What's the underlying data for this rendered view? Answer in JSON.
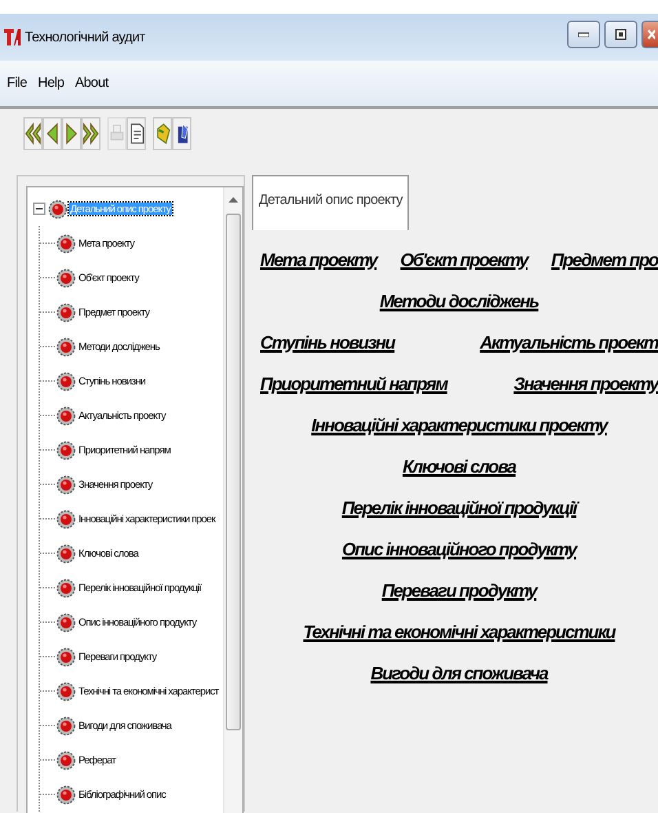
{
  "window": {
    "title": "Технологічний аудит"
  },
  "menu": [
    "File",
    "Help",
    "About"
  ],
  "toolbar": [
    {
      "kind": "first",
      "disabled": false
    },
    {
      "kind": "prev",
      "disabled": false
    },
    {
      "kind": "next",
      "disabled": false
    },
    {
      "kind": "last",
      "disabled": false
    },
    {
      "kind": "print",
      "disabled": true
    },
    {
      "kind": "document",
      "disabled": false
    },
    {
      "kind": "tool",
      "disabled": false
    },
    {
      "kind": "save",
      "disabled": false
    }
  ],
  "tree": {
    "label": "Детальний опис проекту",
    "expanded": true,
    "selected": true,
    "children": [
      {
        "label": "Мета проекту",
        "selected": false
      },
      {
        "label": "Об'єкт проекту",
        "selected": false
      },
      {
        "label": "Предмет проекту",
        "selected": false
      },
      {
        "label": "Методи досліджень",
        "selected": false
      },
      {
        "label": "Ступінь новизни",
        "selected": false
      },
      {
        "label": "Актуальність проекту",
        "selected": false
      },
      {
        "label": "Приоритетний напрям",
        "selected": false
      },
      {
        "label": "Значення проекту",
        "selected": false
      },
      {
        "label": "Інноваційні характеристики проек",
        "selected": false
      },
      {
        "label": "Ключові слова",
        "selected": false
      },
      {
        "label": "Перелік інноваційної продукції",
        "selected": false
      },
      {
        "label": "Опис інноваційного продукту",
        "selected": false
      },
      {
        "label": "Переваги продукту",
        "selected": false
      },
      {
        "label": "Технічні та економічні характерист",
        "selected": false
      },
      {
        "label": "Вигоди для споживача",
        "selected": false
      },
      {
        "label": "Реферат",
        "selected": false
      },
      {
        "label": "Бібліографічний опис",
        "selected": false
      }
    ]
  },
  "tabs": [
    {
      "label": "Детальний опис проекту",
      "selected": true
    }
  ],
  "link_rows": [
    [
      "Мета проекту",
      "Об'єкт проекту",
      "Предмет про"
    ],
    [
      "Методи досліджень"
    ],
    [
      "Ступінь новизни",
      "Актуальність проект"
    ],
    [
      "Приоритетний напрям",
      "Значення проекту"
    ],
    [
      "Інноваційні характеристики проекту"
    ],
    [
      "Ключові слова"
    ],
    [
      "Перелік інноваційної продукції"
    ],
    [
      "Опис інноваційного продукту"
    ],
    [
      "Переваги продукту"
    ],
    [
      "Технічні та економічні характеристики"
    ],
    [
      "Вигоди для споживача"
    ]
  ]
}
